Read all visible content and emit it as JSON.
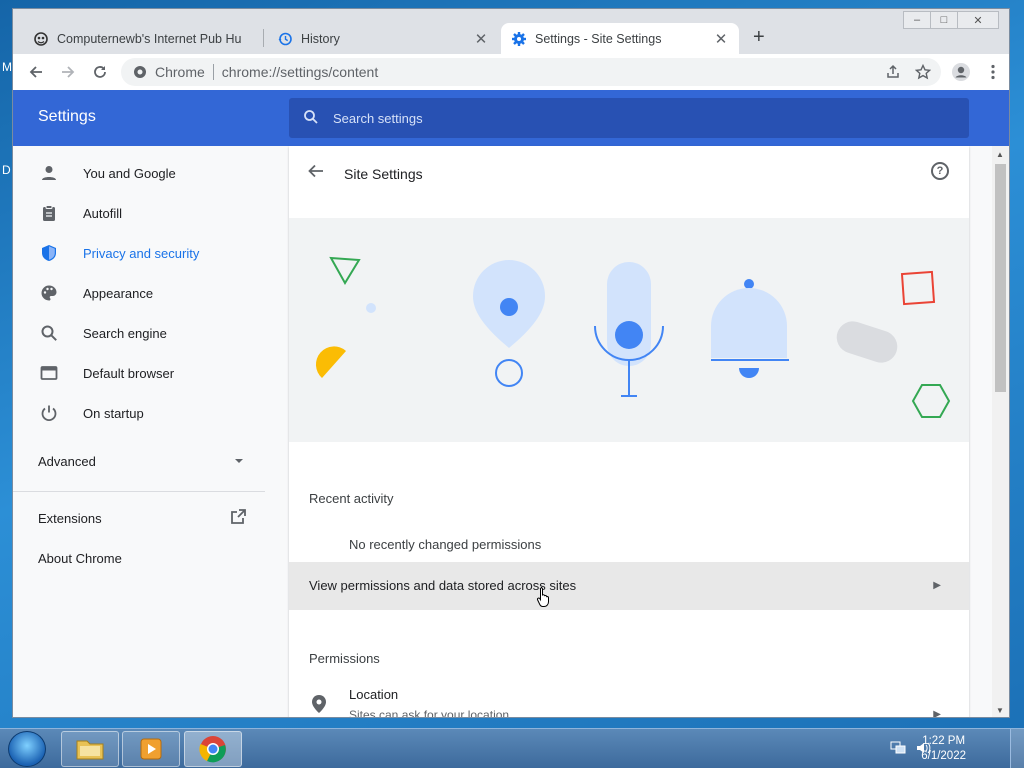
{
  "desktop": {
    "letters": [
      "M",
      "D"
    ]
  },
  "window_controls": {
    "minimize": "–",
    "maximize": "□",
    "close": "✕"
  },
  "tabs": [
    {
      "label": "Computernewb's Internet Pub Hu",
      "close": "✕"
    },
    {
      "label": "History",
      "close": "✕"
    },
    {
      "label": "Settings - Site Settings",
      "close": "✕"
    }
  ],
  "new_tab": "+",
  "omnibox": {
    "site": "Chrome",
    "url": "chrome://settings/content"
  },
  "settings": {
    "title": "Settings",
    "search_placeholder": "Search settings",
    "sidebar": {
      "items": [
        {
          "label": "You and Google"
        },
        {
          "label": "Autofill"
        },
        {
          "label": "Privacy and security"
        },
        {
          "label": "Appearance"
        },
        {
          "label": "Search engine"
        },
        {
          "label": "Default browser"
        },
        {
          "label": "On startup"
        }
      ],
      "advanced": "Advanced",
      "extensions": "Extensions",
      "about": "About Chrome"
    },
    "page": {
      "title": "Site Settings",
      "help": "?",
      "recent_activity": "Recent activity",
      "no_recent": "No recently changed permissions",
      "view_permissions": "View permissions and data stored across sites",
      "permissions": "Permissions",
      "location_label": "Location",
      "location_sub": "Sites can ask for your location"
    }
  },
  "taskbar": {
    "time": "1:22 PM",
    "date": "6/1/2022"
  },
  "colors": {
    "header": "#3367d6",
    "accent": "#1a73e8"
  }
}
